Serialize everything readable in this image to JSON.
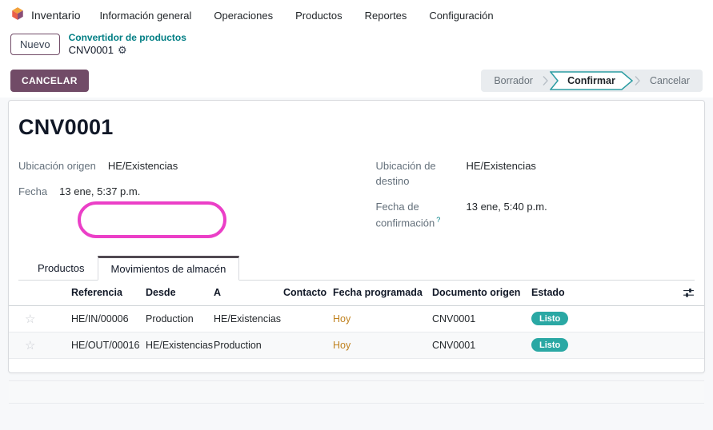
{
  "nav": {
    "app_name": "Inventario",
    "menu_items": [
      "Información general",
      "Operaciones",
      "Productos",
      "Reportes",
      "Configuración"
    ]
  },
  "breadcrumb": {
    "new_button": "Nuevo",
    "parent_link": "Convertidor de productos",
    "current": "CNV0001"
  },
  "actions": {
    "cancel_button": "CANCELAR"
  },
  "statusbar": {
    "steps": [
      {
        "label": "Borrador",
        "active": false
      },
      {
        "label": "Confirmar",
        "active": true
      },
      {
        "label": "Cancelar",
        "active": false
      }
    ]
  },
  "form": {
    "title": "CNV0001",
    "fields": {
      "origin_label": "Ubicación origen",
      "origin_value": "HE/Existencias",
      "date_label": "Fecha",
      "date_value": "13 ene, 5:37 p.m.",
      "dest_label": "Ubicación de destino",
      "dest_value": "HE/Existencias",
      "confirm_date_label": "Fecha de confirmación",
      "confirm_date_help": "?",
      "confirm_date_value": "13 ene, 5:40 p.m."
    },
    "tabs": [
      {
        "label": "Productos",
        "active": false
      },
      {
        "label": "Movimientos de almacén",
        "active": true
      }
    ]
  },
  "table": {
    "columns": [
      "Referencia",
      "Desde",
      "A",
      "Contacto",
      "Fecha programada",
      "Documento origen",
      "Estado"
    ],
    "rows": [
      {
        "reference": "HE/IN/00006",
        "from": "Production",
        "to": "HE/Existencias",
        "contact": "",
        "scheduled": "Hoy",
        "source": "CNV0001",
        "status": "Listo"
      },
      {
        "reference": "HE/OUT/00016",
        "from": "HE/Existencias",
        "to": "Production",
        "contact": "",
        "scheduled": "Hoy",
        "source": "CNV0001",
        "status": "Listo"
      }
    ]
  },
  "icons": {
    "star": "☆",
    "gear": "⚙"
  },
  "colors": {
    "accent_purple": "#714B67",
    "link_teal": "#017E84",
    "status_arrow_teal": "#2D9DA3",
    "badge_teal": "#2AA8A4",
    "scheduled_amber": "#C0821F",
    "annotation_pink": "#EB3FC7",
    "active_tab_top": "#514A52"
  }
}
